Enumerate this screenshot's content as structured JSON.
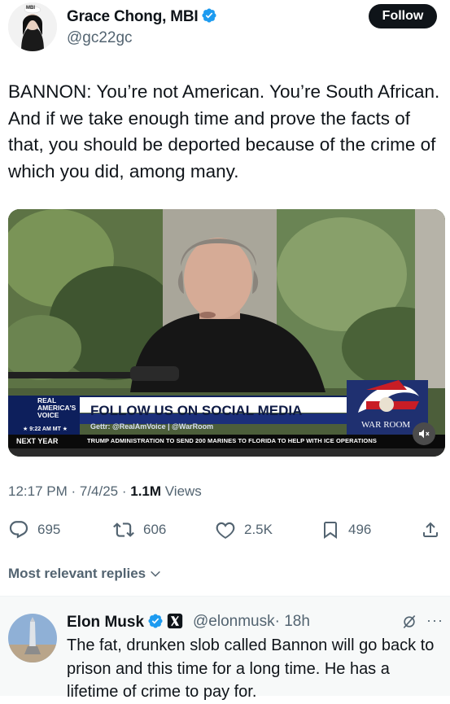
{
  "tweet": {
    "author_name": "Grace Chong, MBI",
    "author_handle": "@gc22gc",
    "avatar_badge": "MBI",
    "follow_label": "Follow",
    "text": "BANNON: You’re not American. You’re South African. And if we take enough time and prove the facts of that, you should be deported because of the crime of which you did, among many.",
    "timestamp": "12:17 PM · 7/4/25 · ",
    "views_count": "1.1M",
    "views_label": " Views"
  },
  "media": {
    "logo_line1": "REAL",
    "logo_line2": "AMERICA'S",
    "logo_line3": "VOICE",
    "banner_title": "FOLLOW US ON SOCIAL MEDIA",
    "banner_sub": "Gettr: @RealAmVoice | @WarRoom",
    "clock": "★ 9:22 AM MT ★",
    "ticker_left": "NEXT YEAR",
    "ticker_right": "TRUMP ADMINISTRATION TO SEND 200 MARINES TO FLORIDA TO HELP WITH ICE OPERATIONS",
    "show_logo": "WAR ROOM"
  },
  "actions": {
    "replies": "695",
    "reposts": "606",
    "likes": "2.5K",
    "bookmarks": "496"
  },
  "replies_section": {
    "label": "Most relevant replies"
  },
  "reply": {
    "author_name": "Elon Musk",
    "author_handle": "@elonmusk",
    "time": "· 18h",
    "text": "The fat, drunken slob called Bannon will go back to prison and this time for a long time. He has a lifetime of crime to pay for."
  },
  "colors": {
    "verified_blue": "#1d9bf0",
    "text_primary": "#0f1419",
    "text_secondary": "#536471"
  }
}
